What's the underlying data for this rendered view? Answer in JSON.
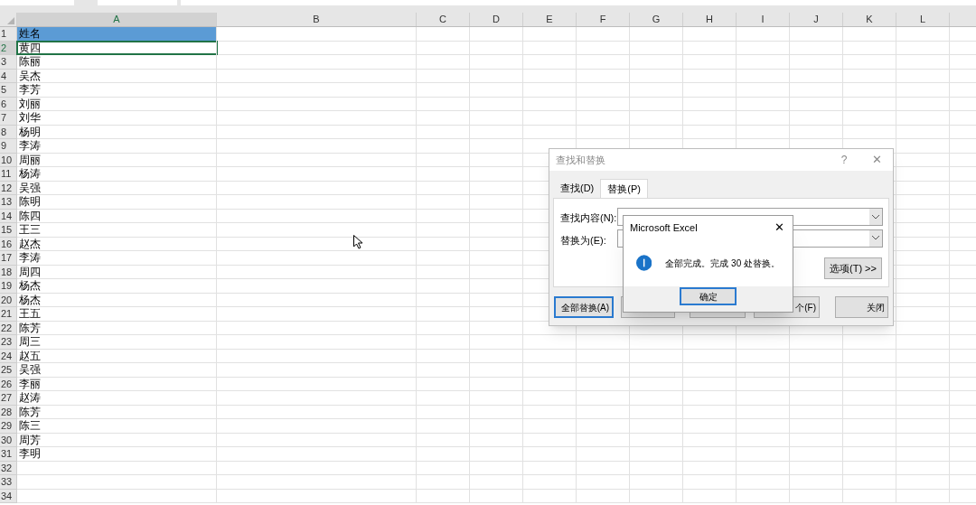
{
  "columns": [
    {
      "label": "A",
      "active": true
    },
    {
      "label": "B",
      "active": false
    },
    {
      "label": "C",
      "active": false
    },
    {
      "label": "D",
      "active": false
    },
    {
      "label": "E",
      "active": false
    },
    {
      "label": "F",
      "active": false
    },
    {
      "label": "G",
      "active": false
    },
    {
      "label": "H",
      "active": false
    },
    {
      "label": "I",
      "active": false
    },
    {
      "label": "J",
      "active": false
    },
    {
      "label": "K",
      "active": false
    },
    {
      "label": "L",
      "active": false
    }
  ],
  "rows": [
    {
      "number": "1",
      "value": "姓名",
      "highlighted": true,
      "active": false
    },
    {
      "number": "2",
      "value": "黄四",
      "highlighted": false,
      "active": true
    },
    {
      "number": "3",
      "value": "陈丽",
      "highlighted": false,
      "active": false
    },
    {
      "number": "4",
      "value": "吴杰",
      "highlighted": false,
      "active": false
    },
    {
      "number": "5",
      "value": "李芳",
      "highlighted": false,
      "active": false
    },
    {
      "number": "6",
      "value": "刘丽",
      "highlighted": false,
      "active": false
    },
    {
      "number": "7",
      "value": "刘华",
      "highlighted": false,
      "active": false
    },
    {
      "number": "8",
      "value": "杨明",
      "highlighted": false,
      "active": false
    },
    {
      "number": "9",
      "value": "李涛",
      "highlighted": false,
      "active": false
    },
    {
      "number": "10",
      "value": "周丽",
      "highlighted": false,
      "active": false
    },
    {
      "number": "11",
      "value": "杨涛",
      "highlighted": false,
      "active": false
    },
    {
      "number": "12",
      "value": "吴强",
      "highlighted": false,
      "active": false
    },
    {
      "number": "13",
      "value": "陈明",
      "highlighted": false,
      "active": false
    },
    {
      "number": "14",
      "value": "陈四",
      "highlighted": false,
      "active": false
    },
    {
      "number": "15",
      "value": "王三",
      "highlighted": false,
      "active": false
    },
    {
      "number": "16",
      "value": "赵杰",
      "highlighted": false,
      "active": false
    },
    {
      "number": "17",
      "value": "李涛",
      "highlighted": false,
      "active": false
    },
    {
      "number": "18",
      "value": "周四",
      "highlighted": false,
      "active": false
    },
    {
      "number": "19",
      "value": "杨杰",
      "highlighted": false,
      "active": false
    },
    {
      "number": "20",
      "value": "杨杰",
      "highlighted": false,
      "active": false
    },
    {
      "number": "21",
      "value": "王五",
      "highlighted": false,
      "active": false
    },
    {
      "number": "22",
      "value": "陈芳",
      "highlighted": false,
      "active": false
    },
    {
      "number": "23",
      "value": "周三",
      "highlighted": false,
      "active": false
    },
    {
      "number": "24",
      "value": "赵五",
      "highlighted": false,
      "active": false
    },
    {
      "number": "25",
      "value": "吴强",
      "highlighted": false,
      "active": false
    },
    {
      "number": "26",
      "value": "李丽",
      "highlighted": false,
      "active": false
    },
    {
      "number": "27",
      "value": "赵涛",
      "highlighted": false,
      "active": false
    },
    {
      "number": "28",
      "value": "陈芳",
      "highlighted": false,
      "active": false
    },
    {
      "number": "29",
      "value": "陈三",
      "highlighted": false,
      "active": false
    },
    {
      "number": "30",
      "value": "周芳",
      "highlighted": false,
      "active": false
    },
    {
      "number": "31",
      "value": "李明",
      "highlighted": false,
      "active": false
    },
    {
      "number": "32",
      "highlighted": false,
      "active": false
    },
    {
      "number": "33",
      "highlighted": false,
      "active": false
    },
    {
      "number": "34",
      "highlighted": false,
      "active": false
    }
  ],
  "find_replace_dialog": {
    "title": "查找和替换",
    "help": "?",
    "close": "✕",
    "tabs": [
      {
        "label": "查找(D)",
        "selected": false
      },
      {
        "label": "替换(P)",
        "selected": true
      }
    ],
    "find_label": "查找内容(N):",
    "replace_label": "替换为(E):",
    "options_button": "选项(T) >>",
    "buttons": [
      {
        "label": "全部替换(A)",
        "focused": true
      },
      {
        "focused": false
      },
      {
        "focused": false
      },
      {
        "label": "个(F)",
        "focused": false
      },
      {
        "label": "关闭",
        "focused": false
      }
    ]
  },
  "message_box": {
    "title": "Microsoft Excel",
    "close": "✕",
    "message": "全部完成。完成 30 处替换。",
    "ok_button": "确定"
  }
}
